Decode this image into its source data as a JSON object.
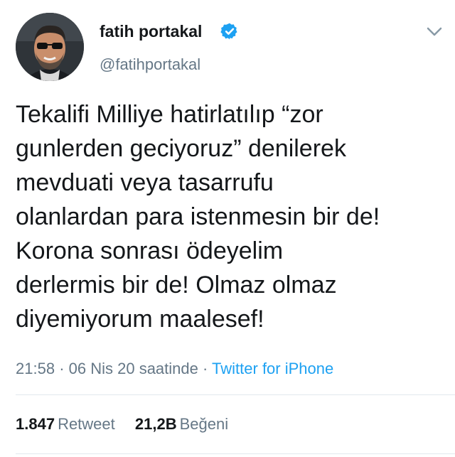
{
  "author": {
    "name": "fatih portakal",
    "handle": "@fatihportakal",
    "verified": true,
    "avatar_icon": "profile-photo"
  },
  "tweet": {
    "text": "Tekalifi Milliye hatirlatılıp “zor\ngunlerden geciyoruz” denilerek\nmevduati veya tasarrufu\nolanlardan para istenmesin bir de!\nKorona sonrası ödeyelim\nderlermis bir de! Olmaz olmaz\ndiyemiyorum maalesef!",
    "time": "21:58",
    "separator": "·",
    "date": "06 Nis 20 saatinde",
    "source": "Twitter for iPhone"
  },
  "stats": {
    "retweets_count": "1.847",
    "retweets_label": "Retweet",
    "likes_count": "21,2B",
    "likes_label": "Beğeni"
  },
  "colors": {
    "text": "#14171a",
    "secondary": "#657786",
    "accent": "#1da1f2",
    "divider": "#e1e8ed"
  },
  "icons": {
    "verified": "verified-badge-icon",
    "menu": "chevron-down-icon"
  }
}
